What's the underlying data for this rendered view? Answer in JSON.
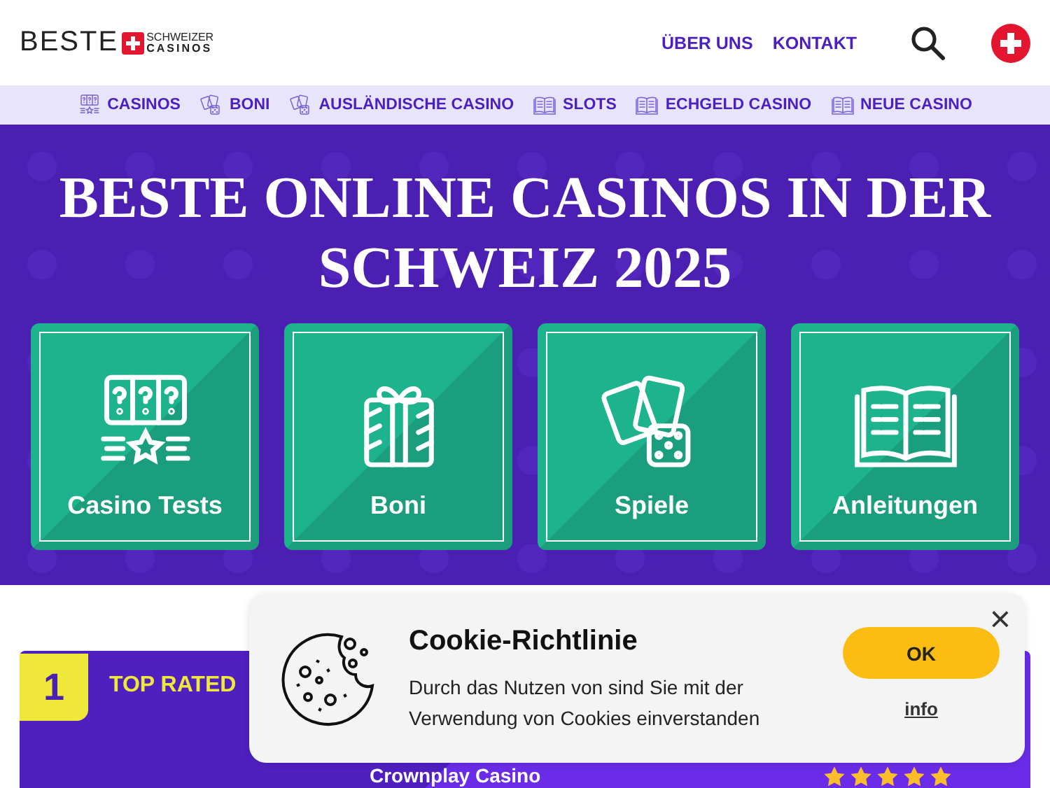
{
  "header": {
    "logo": {
      "word": "BESTE",
      "top": "SCHWEIZER",
      "bottom": "CASINOS"
    },
    "links": [
      "ÜBER UNS",
      "KONTAKT"
    ]
  },
  "nav": [
    {
      "label": "CASINOS",
      "kind": "slot"
    },
    {
      "label": "BONI",
      "kind": "cards"
    },
    {
      "label": "AUSLÄNDISCHE CASINO",
      "kind": "cards"
    },
    {
      "label": "SLOTS",
      "kind": "book"
    },
    {
      "label": "ECHGELD CASINO",
      "kind": "book"
    },
    {
      "label": "NEUE CASINO",
      "kind": "book"
    }
  ],
  "hero": {
    "title": "BESTE ONLINE CASINOS IN DER SCHWEIZ 2025",
    "tiles": [
      {
        "label": "Casino Tests",
        "kind": "slot"
      },
      {
        "label": "Boni",
        "kind": "gift"
      },
      {
        "label": "Spiele",
        "kind": "cards"
      },
      {
        "label": "Anleitungen",
        "kind": "book"
      }
    ]
  },
  "top_card": {
    "rank": "1",
    "badge": "TOP RATED",
    "name": "Crownplay Casino",
    "stars": 5
  },
  "cookie": {
    "title": "Cookie-Richtlinie",
    "text": "Durch das Nutzen von sind Sie mit der Verwendung von Cookies einverstanden",
    "ok": "OK",
    "info": "info",
    "close": "×"
  }
}
